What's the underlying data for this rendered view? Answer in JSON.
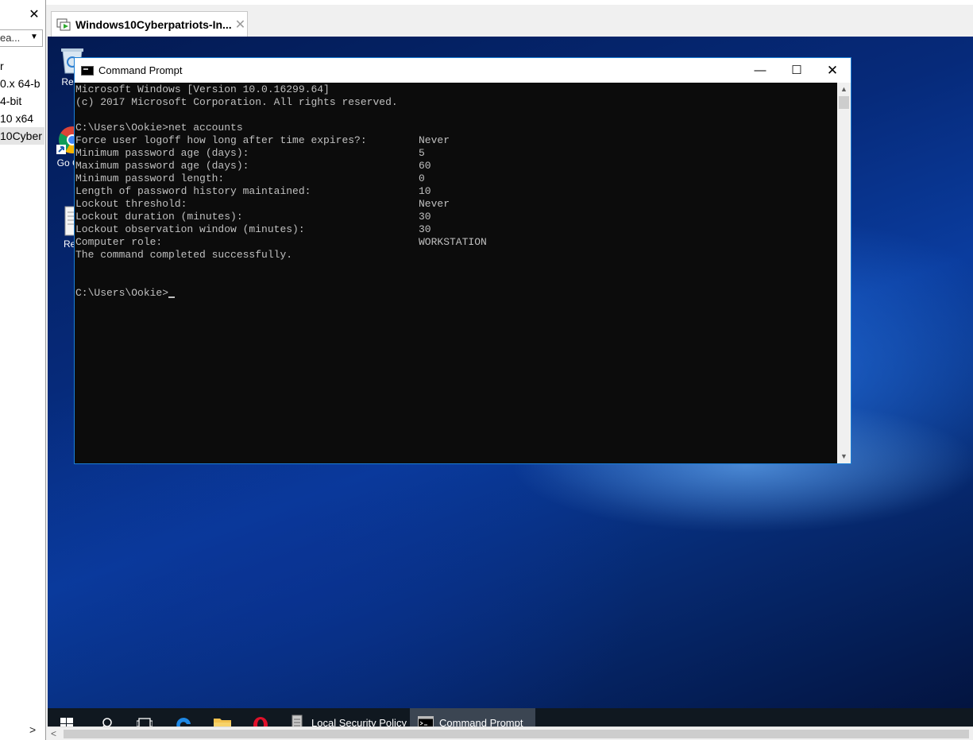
{
  "library": {
    "close_glyph": "✕",
    "search_value": "ea...",
    "search_arrow": "▼",
    "items": [
      {
        "label": "r"
      },
      {
        "label": "0.x 64-b"
      },
      {
        "label": "4-bit"
      },
      {
        "label": " 10 x64"
      },
      {
        "label": "10Cyber"
      }
    ],
    "expand_glyph": ">"
  },
  "vm_tab": {
    "title": "Windows10Cyberpatriots-In...",
    "close_glyph": "✕"
  },
  "desktop": {
    "icons": [
      {
        "label": "Recy",
        "icon": "recycle-bin-icon"
      },
      {
        "label": "Go Chr",
        "icon": "chrome-icon"
      },
      {
        "label": "Rea",
        "icon": "readme-file-icon"
      }
    ]
  },
  "cmd": {
    "title": "Command Prompt",
    "minimize_glyph": "—",
    "maximize_glyph": "☐",
    "close_glyph": "✕",
    "header_lines": [
      "Microsoft Windows [Version 10.0.16299.64]",
      "(c) 2017 Microsoft Corporation. All rights reserved.",
      "",
      "C:\\Users\\Ookie>net accounts"
    ],
    "settings": [
      {
        "label": "Force user logoff how long after time expires?:",
        "value": "Never"
      },
      {
        "label": "Minimum password age (days):",
        "value": "5"
      },
      {
        "label": "Maximum password age (days):",
        "value": "60"
      },
      {
        "label": "Minimum password length:",
        "value": "0"
      },
      {
        "label": "Length of password history maintained:",
        "value": "10"
      },
      {
        "label": "Lockout threshold:",
        "value": "Never"
      },
      {
        "label": "Lockout duration (minutes):",
        "value": "30"
      },
      {
        "label": "Lockout observation window (minutes):",
        "value": "30"
      },
      {
        "label": "Computer role:",
        "value": "WORKSTATION"
      }
    ],
    "completion": "The command completed successfully.",
    "prompt": "C:\\Users\\Ookie>"
  },
  "taskbar": {
    "items": [
      {
        "name": "start",
        "icon": "windows-start-icon"
      },
      {
        "name": "search",
        "icon": "search-icon"
      },
      {
        "name": "task-view",
        "icon": "task-view-icon"
      },
      {
        "name": "edge",
        "icon": "edge-icon"
      },
      {
        "name": "file-explorer",
        "icon": "folder-icon"
      },
      {
        "name": "opera",
        "icon": "opera-icon"
      },
      {
        "name": "local-security-policy",
        "label": "Local Security Policy",
        "icon": "security-policy-icon"
      },
      {
        "name": "command-prompt",
        "label": "Command Prompt",
        "icon": "cmd-icon"
      }
    ]
  },
  "hscroll": {
    "left_glyph": "<"
  },
  "colors": {
    "cmd_bg": "#0c0c0c",
    "cmd_text": "#c0c0c0",
    "window_border": "#1a7fd6",
    "taskbar_bg": "#101820"
  }
}
